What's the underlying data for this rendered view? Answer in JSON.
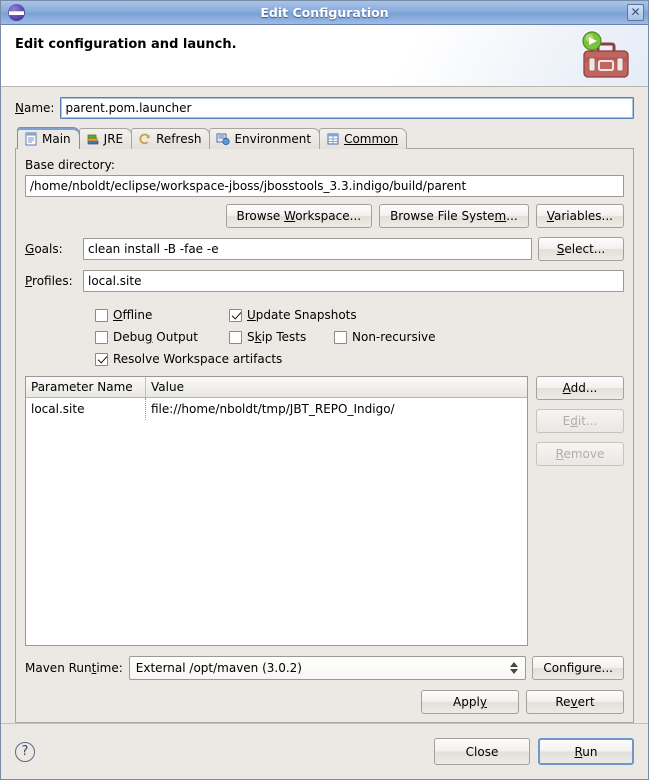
{
  "window": {
    "title": "Edit Configuration",
    "icon": "eclipse-globe-icon",
    "close_label": "✕"
  },
  "banner": {
    "title": "Edit configuration and launch.",
    "icon": "maven-toolbox-run-icon"
  },
  "name_field": {
    "label": "Name:",
    "value": "parent.pom.launcher",
    "placeholder": ""
  },
  "tabs": [
    {
      "label": "Main",
      "icon": "document-icon",
      "active": true
    },
    {
      "label": "JRE",
      "icon": "books-icon",
      "active": false
    },
    {
      "label": "Refresh",
      "icon": "refresh-icon",
      "active": false
    },
    {
      "label": "Environment",
      "icon": "environment-icon",
      "active": false
    },
    {
      "label": "Common",
      "icon": "common-table-icon",
      "active": false
    }
  ],
  "main_tab": {
    "base_directory": {
      "label": "Base directory:",
      "value": "/home/nboldt/eclipse/workspace-jboss/jbosstools_3.3.indigo/build/parent",
      "placeholder": ""
    },
    "browse_buttons": [
      {
        "label": "Browse Workspace...",
        "name": "browse-workspace-button"
      },
      {
        "label": "Browse File System...",
        "name": "browse-file-system-button"
      },
      {
        "label": "Variables...",
        "name": "variables-button"
      }
    ],
    "goals": {
      "label": "Goals:",
      "value": "clean install -B -fae -e",
      "placeholder": "",
      "select_button": "Select..."
    },
    "profiles": {
      "label": "Profiles:",
      "value": "local.site",
      "placeholder": ""
    },
    "checkboxes": [
      {
        "label": "Offline",
        "checked": false,
        "name": "checkbox-offline"
      },
      {
        "label": "Update Snapshots",
        "checked": true,
        "name": "checkbox-update-snapshots"
      },
      {
        "label": "Debug Output",
        "checked": false,
        "name": "checkbox-debug-output"
      },
      {
        "label": "Skip Tests",
        "checked": false,
        "name": "checkbox-skip-tests"
      },
      {
        "label": "Non-recursive",
        "checked": false,
        "name": "checkbox-non-recursive"
      },
      {
        "label": "Resolve Workspace artifacts",
        "checked": true,
        "name": "checkbox-resolve-workspace-artifacts"
      }
    ],
    "parameters_table": {
      "columns": [
        "Parameter Name",
        "Value"
      ],
      "rows": [
        {
          "name": "local.site",
          "value": "file://home/nboldt/tmp/JBT_REPO_Indigo/"
        }
      ]
    },
    "table_buttons": [
      {
        "label": "Add...",
        "enabled": true,
        "name": "add-parameter-button"
      },
      {
        "label": "Edit...",
        "enabled": false,
        "name": "edit-parameter-button"
      },
      {
        "label": "Remove",
        "enabled": false,
        "name": "remove-parameter-button"
      }
    ],
    "maven_runtime": {
      "label": "Maven Runtime:",
      "value": "External /opt/maven (3.0.2)",
      "configure_button": "Configure..."
    },
    "apply_label": "Apply",
    "revert_label": "Revert"
  },
  "footer": {
    "help_label": "?",
    "close_label": "Close",
    "run_label": "Run"
  },
  "colors": {
    "titlebar_accent": "#7ba1d6",
    "dialog_background": "#ece9e4",
    "field_background": "#ffffff",
    "default_button_border": "#6f97cc",
    "disabled_text": "#b0aeaa"
  }
}
